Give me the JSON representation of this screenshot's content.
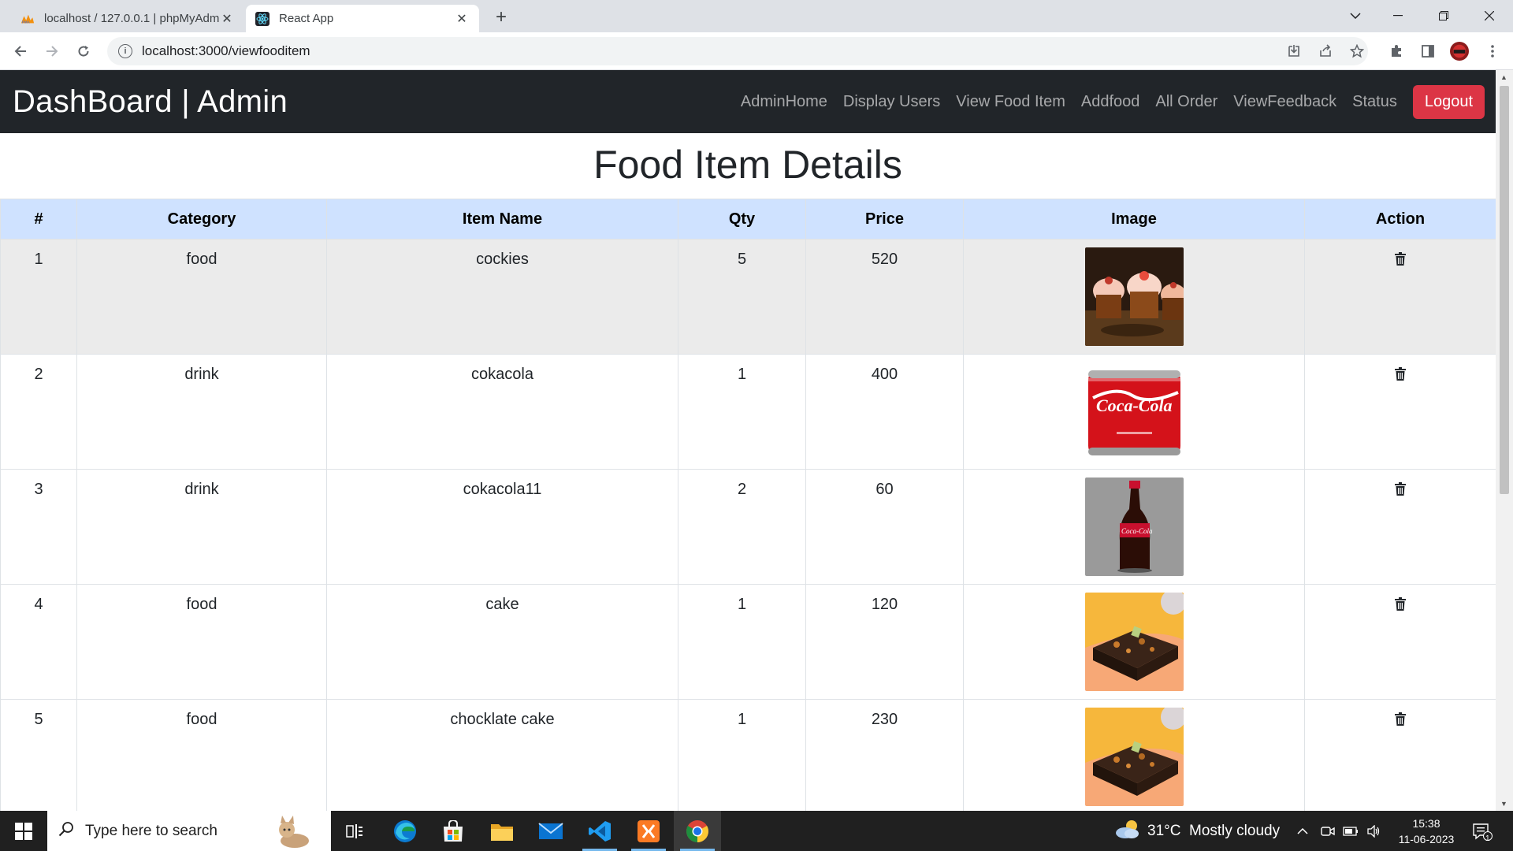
{
  "browser": {
    "tabs": [
      {
        "title": "localhost / 127.0.0.1 | phpMyAdm",
        "icon": "phpmyadmin-icon",
        "active": false
      },
      {
        "title": "React App",
        "icon": "react-icon",
        "active": true
      }
    ],
    "url": "localhost:3000/viewfooditem"
  },
  "navbar": {
    "brand": "DashBoard | Admin",
    "links": [
      "AdminHome",
      "Display Users",
      "View Food Item",
      "Addfood",
      "All Order",
      "ViewFeedback",
      "Status"
    ],
    "logout_label": "Logout"
  },
  "page": {
    "title": "Food Item Details"
  },
  "table": {
    "headers": [
      "#",
      "Category",
      "Item Name",
      "Qty",
      "Price",
      "Image",
      "Action"
    ],
    "rows": [
      {
        "num": "1",
        "category": "food",
        "name": "cockies",
        "qty": "5",
        "price": "520",
        "image": "cupcakes-photo"
      },
      {
        "num": "2",
        "category": "drink",
        "name": "cokacola",
        "qty": "1",
        "price": "400",
        "image": "coca-cola-can-photo"
      },
      {
        "num": "3",
        "category": "drink",
        "name": "cokacola11",
        "qty": "2",
        "price": "60",
        "image": "coca-cola-bottle-photo"
      },
      {
        "num": "4",
        "category": "food",
        "name": "cake",
        "qty": "1",
        "price": "120",
        "image": "chocolate-cake-photo"
      },
      {
        "num": "5",
        "category": "food",
        "name": "chocklate cake",
        "qty": "1",
        "price": "230",
        "image": "chocolate-cake-photo"
      }
    ]
  },
  "taskbar": {
    "search_placeholder": "Type here to search",
    "weather": "31°C  Mostly cloudy",
    "time": "15:38",
    "date": "11-06-2023",
    "notification_count": "1"
  },
  "colors": {
    "navbar_bg": "#212529",
    "logout_bg": "#dc3545",
    "table_header_bg": "#cfe2ff",
    "striped_row_bg": "#ebebeb"
  }
}
